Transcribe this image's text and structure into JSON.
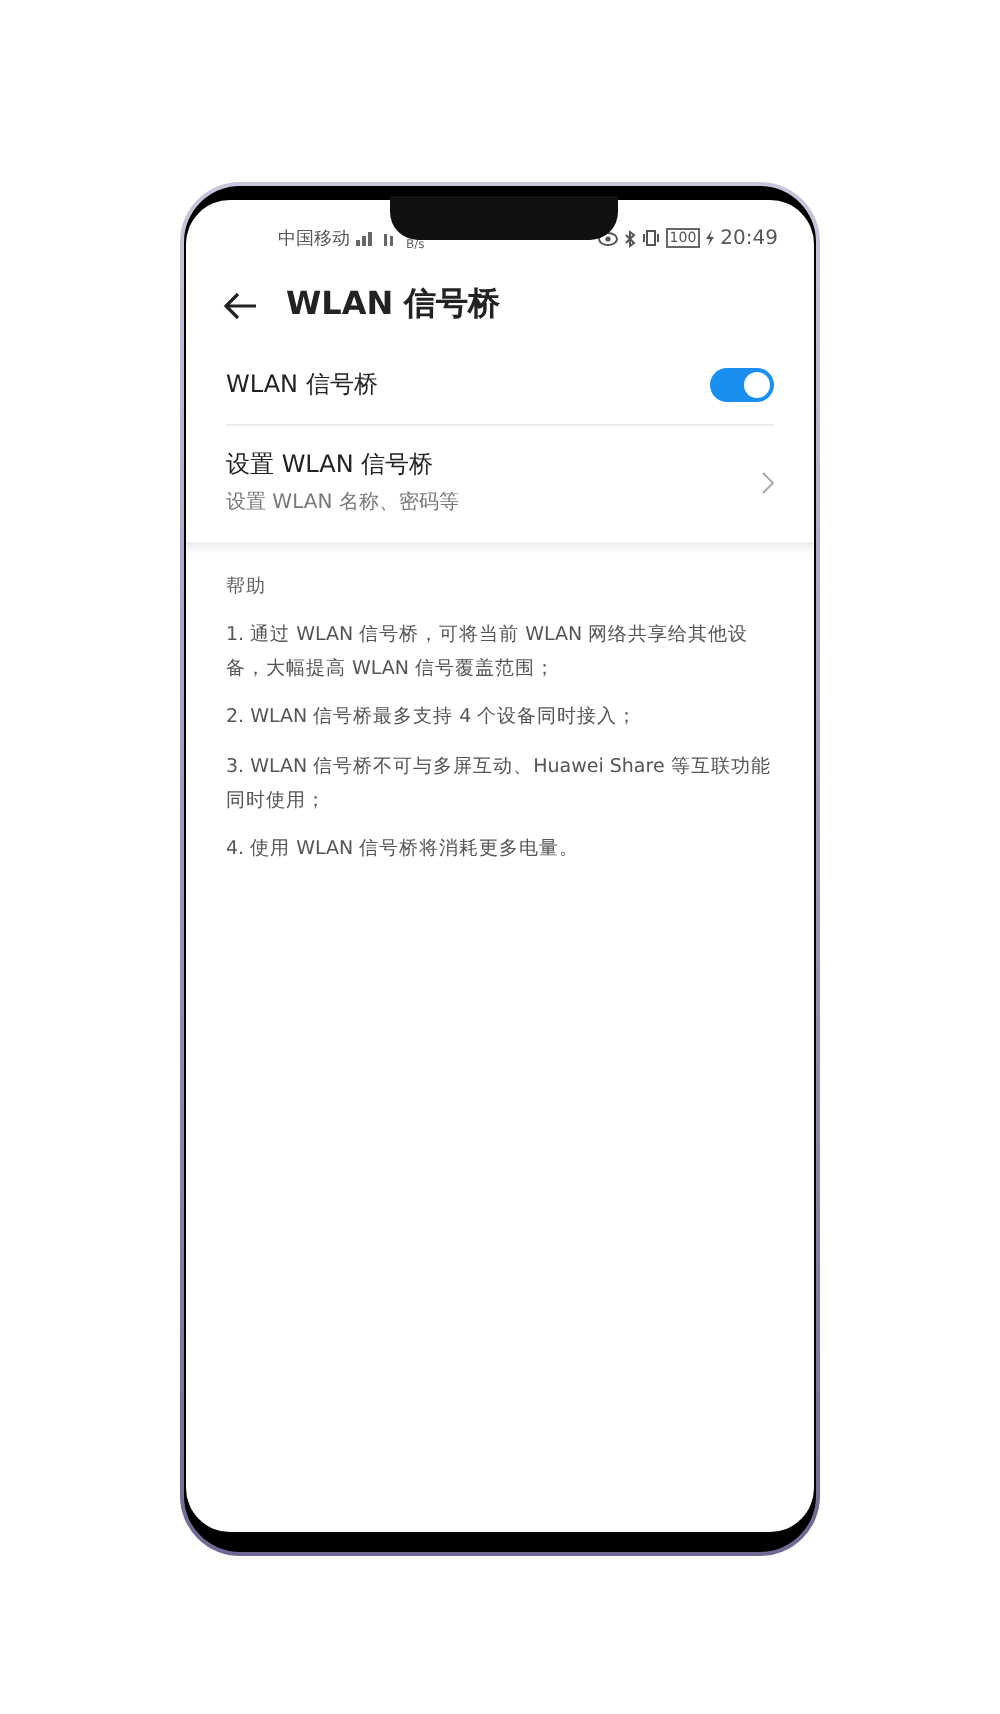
{
  "status_bar": {
    "carrier": "中国移动",
    "speed": "B/s",
    "battery": "100",
    "time": "20:49"
  },
  "header": {
    "title": "WLAN 信号桥"
  },
  "settings": [
    {
      "kind": "toggle",
      "label": "WLAN 信号桥",
      "on": true
    },
    {
      "kind": "link",
      "label": "设置 WLAN 信号桥",
      "subtitle": "设置 WLAN 名称、密码等"
    }
  ],
  "help": {
    "title": "帮助",
    "items": [
      "1. 通过 WLAN 信号桥，可将当前 WLAN 网络共享给其他设备，大幅提高 WLAN 信号覆盖范围；",
      "2. WLAN 信号桥最多支持 4 个设备同时接入；",
      "3. WLAN 信号桥不可与多屏互动、Huawei Share 等互联功能同时使用；",
      "4. 使用 WLAN 信号桥将消耗更多电量。"
    ]
  }
}
